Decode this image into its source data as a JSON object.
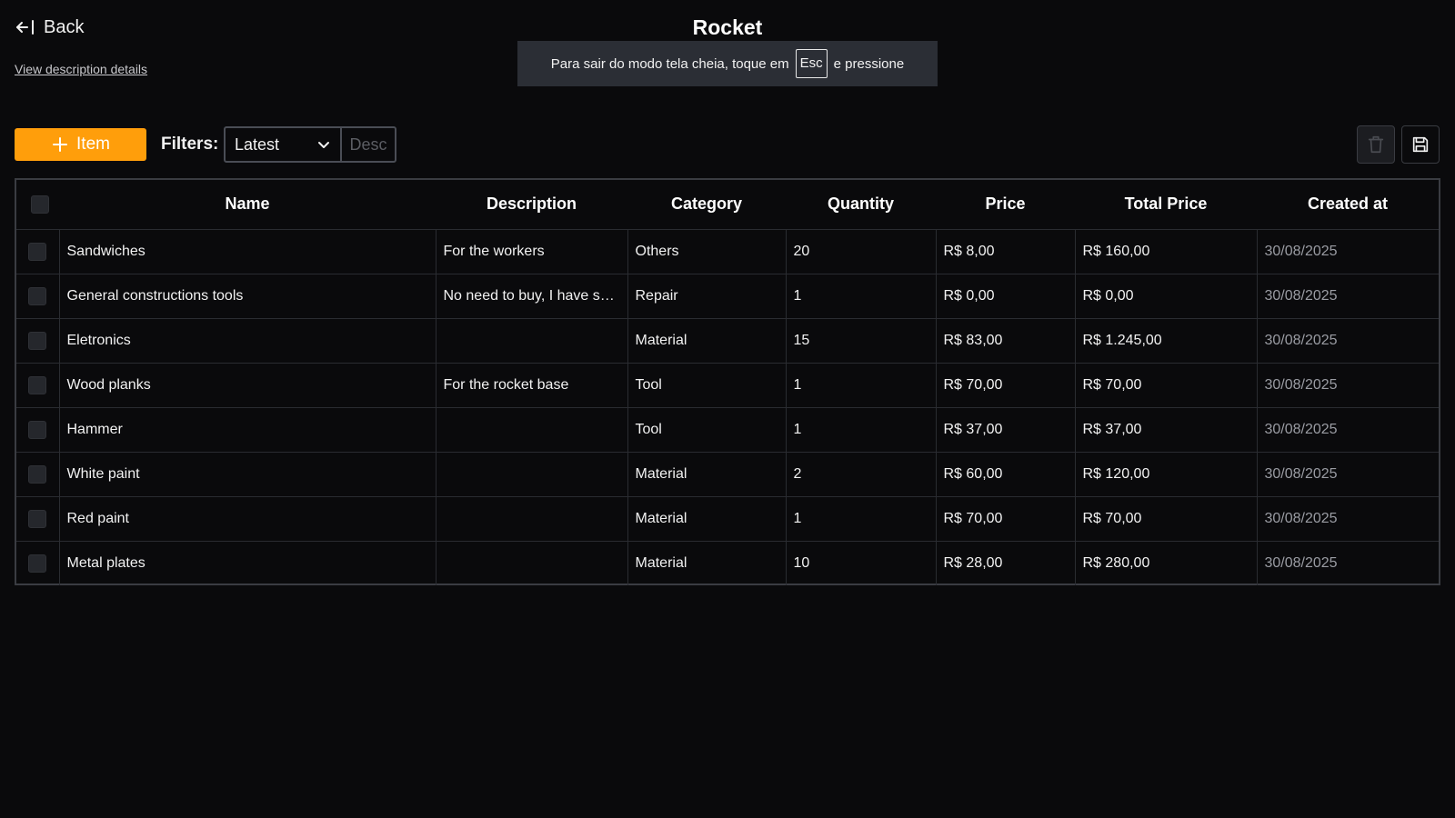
{
  "header": {
    "back_label": "Back",
    "view_details_label": "View description details",
    "title": "Rocket"
  },
  "fullscreen_toast": {
    "text_before": "Para sair do modo tela cheia, toque em",
    "key": "Esc",
    "text_after": "e pressione"
  },
  "toolbar": {
    "add_label": "Item",
    "filters_label": "Filters:",
    "sort_select_value": "Latest",
    "order_label": "Desc"
  },
  "colors": {
    "accent": "#ff9e0b",
    "background": "#0a0a0c"
  },
  "table": {
    "columns": [
      "Name",
      "Description",
      "Category",
      "Quantity",
      "Price",
      "Total Price",
      "Created at"
    ],
    "rows": [
      {
        "name": "Sandwiches",
        "description": "For the workers",
        "category": "Others",
        "quantity": "20",
        "price": "R$ 8,00",
        "total": "R$ 160,00",
        "created": "30/08/2025"
      },
      {
        "name": "General constructions tools",
        "description": "No need to buy, I have so…",
        "category": "Repair",
        "quantity": "1",
        "price": "R$ 0,00",
        "total": "R$ 0,00",
        "created": "30/08/2025"
      },
      {
        "name": "Eletronics",
        "description": "",
        "category": "Material",
        "quantity": "15",
        "price": "R$ 83,00",
        "total": "R$ 1.245,00",
        "created": "30/08/2025"
      },
      {
        "name": "Wood planks",
        "description": "For the rocket base",
        "category": "Tool",
        "quantity": "1",
        "price": "R$ 70,00",
        "total": "R$ 70,00",
        "created": "30/08/2025"
      },
      {
        "name": "Hammer",
        "description": "",
        "category": "Tool",
        "quantity": "1",
        "price": "R$ 37,00",
        "total": "R$ 37,00",
        "created": "30/08/2025"
      },
      {
        "name": "White paint",
        "description": "",
        "category": "Material",
        "quantity": "2",
        "price": "R$ 60,00",
        "total": "R$ 120,00",
        "created": "30/08/2025"
      },
      {
        "name": "Red paint",
        "description": "",
        "category": "Material",
        "quantity": "1",
        "price": "R$ 70,00",
        "total": "R$ 70,00",
        "created": "30/08/2025"
      },
      {
        "name": "Metal plates",
        "description": "",
        "category": "Material",
        "quantity": "10",
        "price": "R$ 28,00",
        "total": "R$ 280,00",
        "created": "30/08/2025"
      }
    ]
  }
}
